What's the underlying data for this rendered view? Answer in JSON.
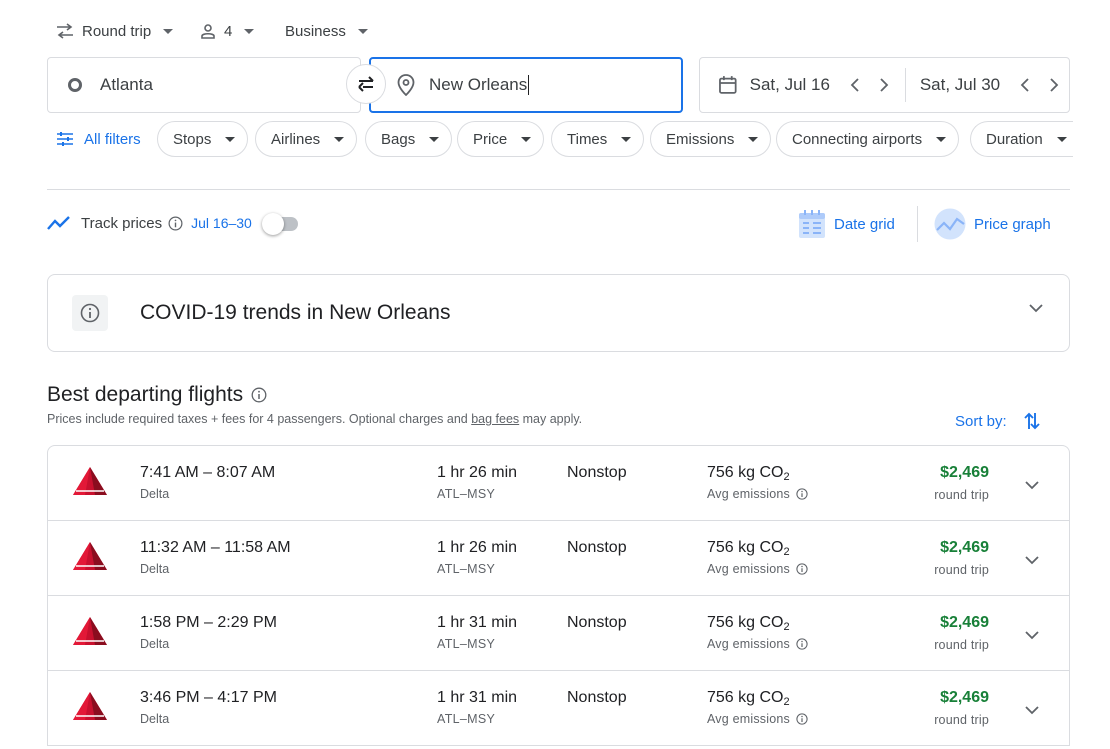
{
  "options": {
    "trip_type": "Round trip",
    "passengers": "4",
    "cabin_class": "Business"
  },
  "search": {
    "origin": "Atlanta",
    "destination": "New Orleans",
    "depart_date": "Sat, Jul 16",
    "return_date": "Sat, Jul 30"
  },
  "filters": {
    "all_filters": "All filters",
    "chips": [
      "Stops",
      "Airlines",
      "Bags",
      "Price",
      "Times",
      "Emissions",
      "Connecting airports",
      "Duration"
    ]
  },
  "track": {
    "label": "Track prices",
    "dates": "Jul 16–30",
    "enabled": false
  },
  "tools": {
    "date_grid": "Date grid",
    "price_graph": "Price graph"
  },
  "covid": {
    "title": "COVID-19 trends in New Orleans"
  },
  "results": {
    "title": "Best departing flights",
    "note_prefix": "Prices include required taxes + fees for 4 passengers. Optional charges and ",
    "note_link": "bag fees",
    "note_suffix": " may apply.",
    "sort_label": "Sort by:",
    "flights": [
      {
        "times": "7:41 AM – 8:07 AM",
        "airline": "Delta",
        "duration": "1 hr 26 min",
        "route": "ATL–MSY",
        "stops": "Nonstop",
        "co2": "756 kg CO",
        "co2_sub": "2",
        "emissions": "Avg emissions",
        "price": "$2,469",
        "trip": "round trip"
      },
      {
        "times": "11:32 AM – 11:58 AM",
        "airline": "Delta",
        "duration": "1 hr 26 min",
        "route": "ATL–MSY",
        "stops": "Nonstop",
        "co2": "756 kg CO",
        "co2_sub": "2",
        "emissions": "Avg emissions",
        "price": "$2,469",
        "trip": "round trip"
      },
      {
        "times": "1:58 PM – 2:29 PM",
        "airline": "Delta",
        "duration": "1 hr 31 min",
        "route": "ATL–MSY",
        "stops": "Nonstop",
        "co2": "756 kg CO",
        "co2_sub": "2",
        "emissions": "Avg emissions",
        "price": "$2,469",
        "trip": "round trip"
      },
      {
        "times": "3:46 PM – 4:17 PM",
        "airline": "Delta",
        "duration": "1 hr 31 min",
        "route": "ATL–MSY",
        "stops": "Nonstop",
        "co2": "756 kg CO",
        "co2_sub": "2",
        "emissions": "Avg emissions",
        "price": "$2,469",
        "trip": "round trip"
      }
    ]
  },
  "colors": {
    "accent": "#1a73e8",
    "price_green": "#188038",
    "delta_red": "#c8102e"
  }
}
